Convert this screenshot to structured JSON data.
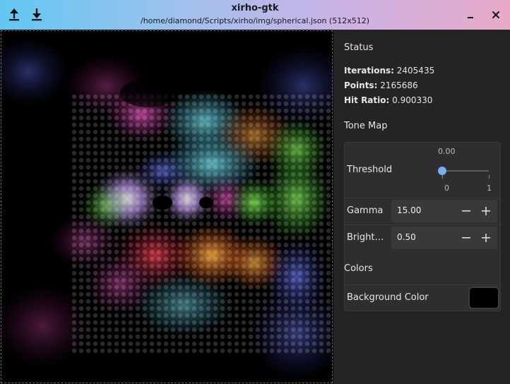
{
  "window": {
    "title": "xirho-gtk",
    "subtitle": "/home/diamond/Scripts/xirho/img/spherical.json (512x512)"
  },
  "toolbar": {
    "open_icon": "upload-icon",
    "save_icon": "download-icon",
    "minimize_icon": "minimize-icon",
    "close_icon": "close-icon"
  },
  "status": {
    "title": "Status",
    "iterations_label": "Iterations:",
    "iterations_value": "2405435",
    "points_label": "Points:",
    "points_value": "2165686",
    "hit_ratio_label": "Hit Ratio:",
    "hit_ratio_value": "0.900330"
  },
  "tonemap": {
    "title": "Tone Map",
    "threshold_label": "Threshold",
    "threshold_value": "0.00",
    "threshold_min": "0",
    "threshold_max": "1",
    "threshold_level": 0.0,
    "gamma_label": "Gamma",
    "gamma_value": "15.00",
    "brightness_label": "Bright…",
    "brightness_value": "0.50"
  },
  "colors": {
    "title": "Colors",
    "background_label": "Background Color",
    "background_color": "#000000"
  }
}
